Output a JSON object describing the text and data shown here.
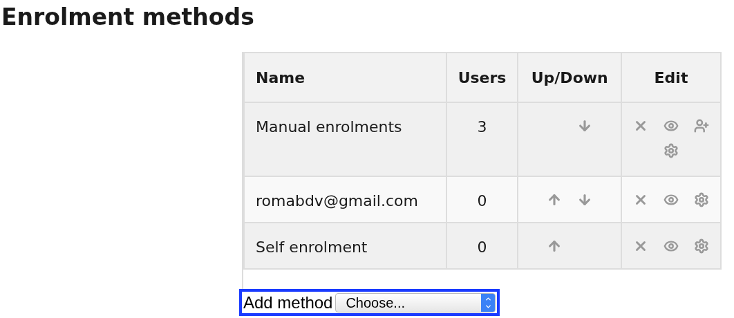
{
  "heading": "Enrolment methods",
  "table": {
    "columns": [
      "Name",
      "Users",
      "Up/Down",
      "Edit"
    ],
    "rows": [
      {
        "name": "Manual enrolments",
        "users": "3",
        "can_move_up": false,
        "can_move_down": true,
        "actions": [
          {
            "kind": "delete"
          },
          {
            "kind": "hide"
          },
          {
            "kind": "enrol-users"
          },
          {
            "kind": "settings"
          }
        ]
      },
      {
        "name": "romabdv@gmail.com",
        "users": "0",
        "can_move_up": true,
        "can_move_down": true,
        "actions": [
          {
            "kind": "delete"
          },
          {
            "kind": "hide"
          },
          {
            "kind": "settings"
          }
        ]
      },
      {
        "name": "Self enrolment",
        "users": "0",
        "can_move_up": true,
        "can_move_down": false,
        "actions": [
          {
            "kind": "delete"
          },
          {
            "kind": "hide"
          },
          {
            "kind": "settings"
          }
        ]
      }
    ]
  },
  "add_method": {
    "label": "Add method",
    "value": "Choose..."
  }
}
